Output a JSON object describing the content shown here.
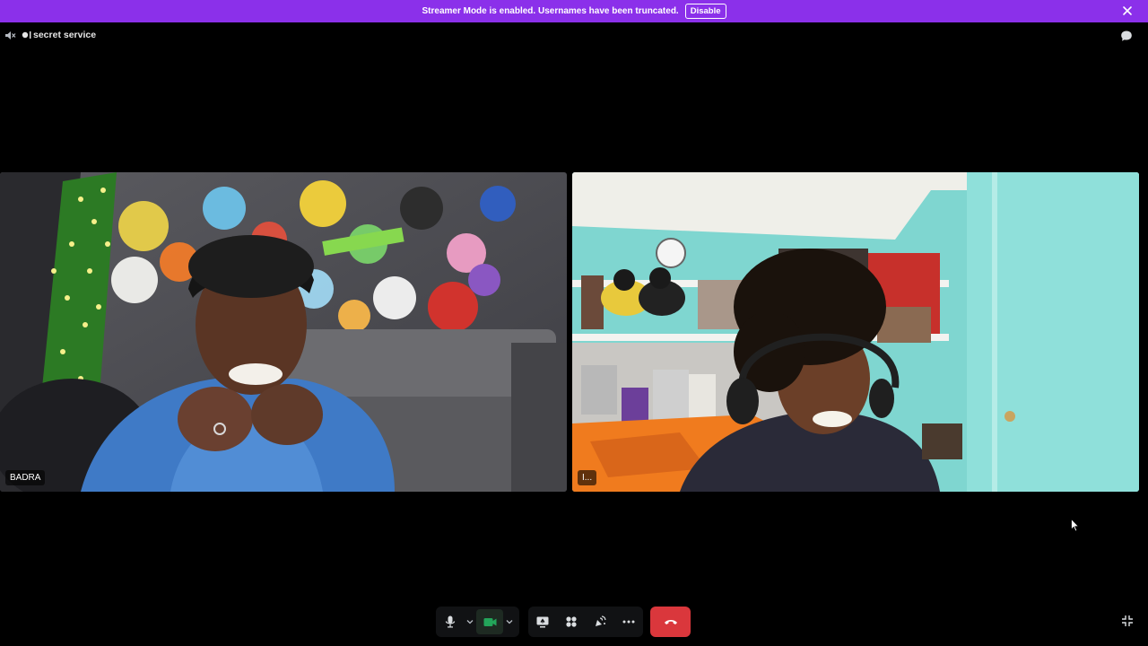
{
  "banner": {
    "message": "Streamer Mode is enabled. Usernames have been truncated.",
    "disable_label": "Disable"
  },
  "header": {
    "channel_name": "secret service"
  },
  "participants": [
    {
      "name": "BADRA"
    },
    {
      "name": "I..."
    }
  ],
  "icons": {
    "banner_close": "close-icon",
    "speaker": "speaker-muted-icon",
    "chat": "chat-bubble-icon",
    "mic": "microphone-icon",
    "camera": "video-camera-icon",
    "screen_share": "screen-share-icon",
    "activities": "activities-icon",
    "soundboard": "soundboard-icon",
    "more": "more-options-icon",
    "end_call": "end-call-icon",
    "exit_fullscreen": "exit-fullscreen-icon"
  },
  "colors": {
    "banner": "#8b30ea",
    "end_call": "#da373c",
    "camera_active": "#23a55a"
  }
}
